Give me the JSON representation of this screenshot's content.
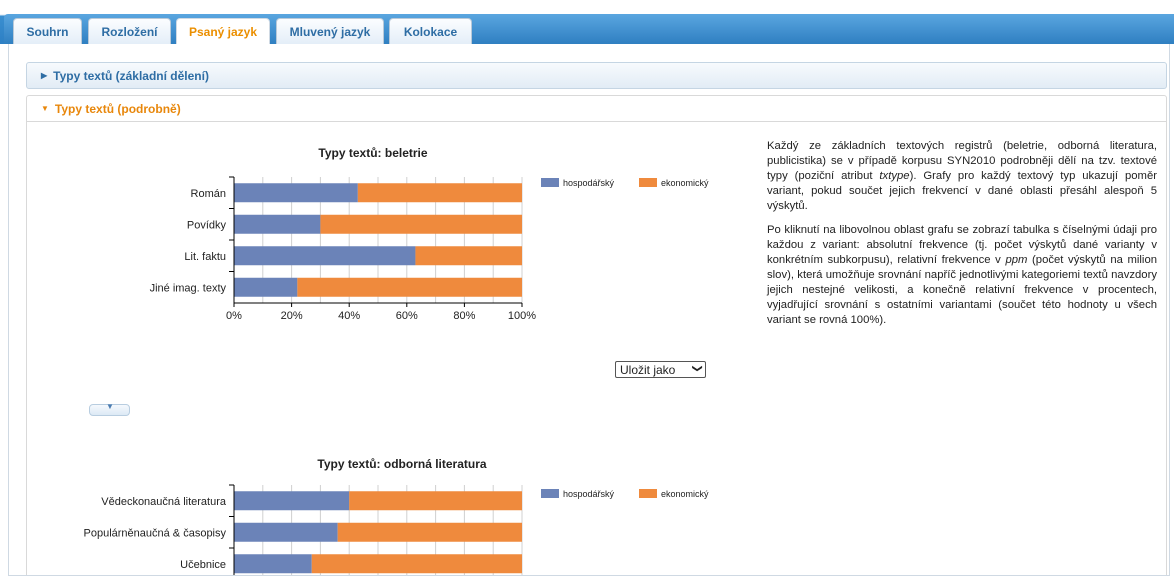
{
  "tabs": [
    {
      "label": "Souhrn",
      "active": false
    },
    {
      "label": "Rozložení",
      "active": false
    },
    {
      "label": "Psaný jazyk",
      "active": true
    },
    {
      "label": "Mluvený jazyk",
      "active": false
    },
    {
      "label": "Kolokace",
      "active": false
    }
  ],
  "accordion": {
    "basic_label": "Typy textů (základní dělení)",
    "detail_label": "Typy textů (podrobně)"
  },
  "description": {
    "p1_a": "Každý ze základních textových registrů (beletrie, odborná literatura, publicistika) se v případě korpusu SYN2010 podrobněji dělí na tzv. textové typy (poziční atribut ",
    "p1_em": "txtype",
    "p1_b": "). Grafy pro každý textový typ ukazují poměr variant, pokud součet jejich frekvencí v dané oblasti přesáhl alespoň 5 výskytů.",
    "p2_a": "Po kliknutí na libovolnou oblast grafu se zobrazí tabulka s číselnými údaji pro každou z variant: absolutní frekvence (tj. počet výskytů dané varianty v konkrétním subkorpusu), relativní frekvence v ",
    "p2_em": "ppm",
    "p2_b": " (počet výskytů na milion slov), která umožňuje srovnání napříč jednotlivými kategoriemi textů navzdory jejich nestejné velikosti, a konečně relativní frekvence v procentech, vyjadřující srovnání s ostatními variantami (součet této hodnoty u všech variant se rovná 100%)."
  },
  "save_select": {
    "label": "Uložit jako"
  },
  "colors": {
    "series1": "#6b83b8",
    "series2": "#ef8a3d"
  },
  "chart_data": [
    {
      "type": "bar",
      "orientation": "horizontal",
      "stacked": "percent",
      "title": "Typy textů: beletrie",
      "categories": [
        "Román",
        "Povídky",
        "Lit. faktu",
        "Jiné imag. texty"
      ],
      "series": [
        {
          "name": "hospodářský",
          "values": [
            43,
            30,
            63,
            22
          ]
        },
        {
          "name": "ekonomický",
          "values": [
            57,
            70,
            37,
            78
          ]
        }
      ],
      "xticks": [
        "0%",
        "20%",
        "40%",
        "60%",
        "80%",
        "100%"
      ],
      "xlim": [
        0,
        100
      ],
      "legend": "right"
    },
    {
      "type": "bar",
      "orientation": "horizontal",
      "stacked": "percent",
      "title": "Typy textů: odborná literatura",
      "categories": [
        "Vědeckonaučná literatura",
        "Populárněnaučná & časopisy",
        "Učebnice"
      ],
      "series": [
        {
          "name": "hospodářský",
          "values": [
            40,
            36,
            27
          ]
        },
        {
          "name": "ekonomický",
          "values": [
            60,
            64,
            73
          ]
        }
      ],
      "xlim": [
        0,
        100
      ],
      "legend": "right"
    }
  ]
}
